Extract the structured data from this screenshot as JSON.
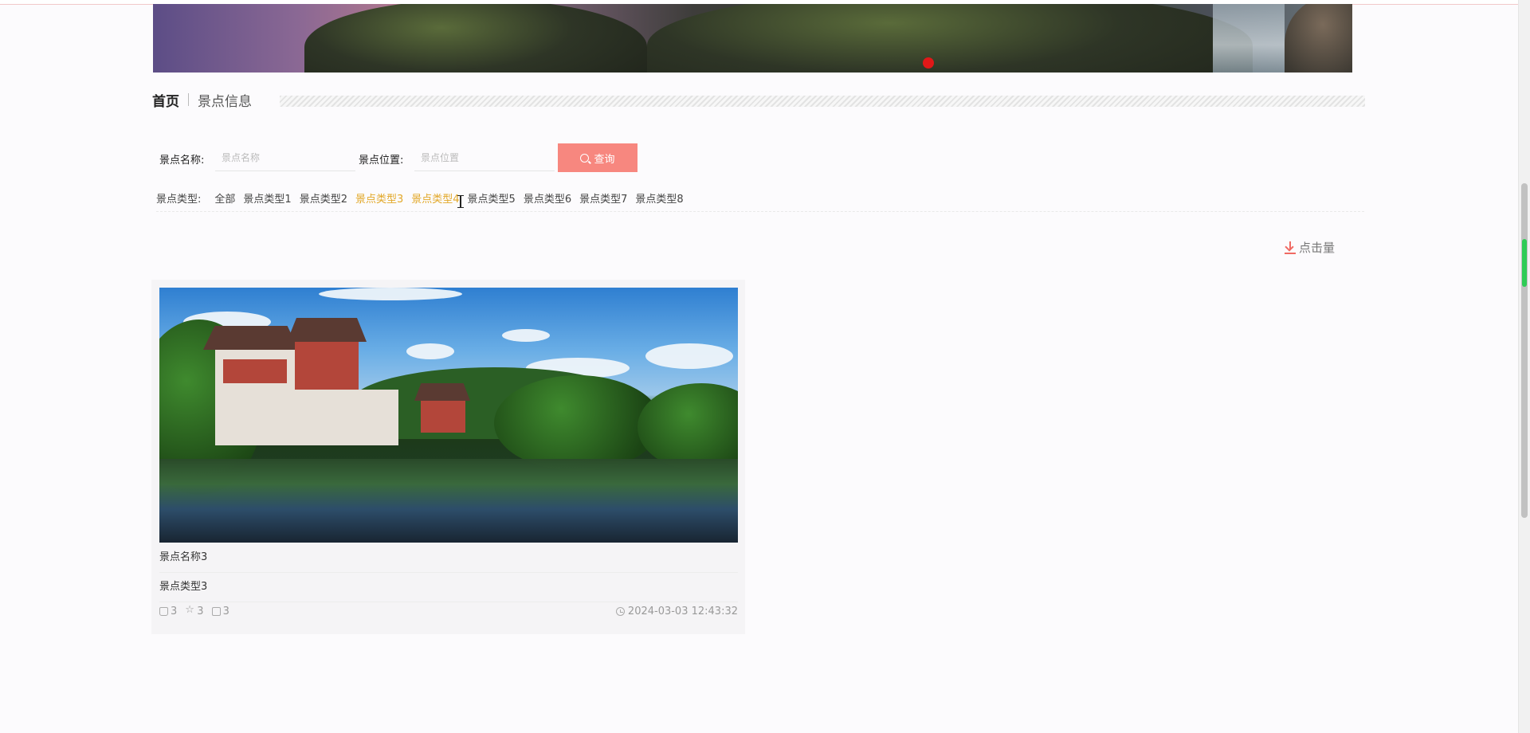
{
  "breadcrumb": {
    "home": "首页",
    "current": "景点信息"
  },
  "search": {
    "name_label": "景点名称:",
    "name_placeholder": "景点名称",
    "name_value": "",
    "location_label": "景点位置:",
    "location_placeholder": "景点位置",
    "location_value": "",
    "query_label": "查询"
  },
  "types": {
    "label": "景点类型:",
    "items": [
      "全部",
      "景点类型1",
      "景点类型2",
      "景点类型3",
      "景点类型4",
      "景点类型5",
      "景点类型6",
      "景点类型7",
      "景点类型8"
    ],
    "active": [
      "景点类型3",
      "景点类型4"
    ]
  },
  "sort": {
    "label": "点击量",
    "icon": "download-icon"
  },
  "cards": [
    {
      "name": "景点名称3",
      "type": "景点类型3",
      "likes": "3",
      "favorites": "3",
      "comments": "3",
      "time": "2024-03-03 12:43:32"
    }
  ],
  "colors": {
    "accent": "#f7877f",
    "active_type": "#e2a829",
    "banner_dot": "#e01818",
    "background": "#fcfbfd"
  }
}
